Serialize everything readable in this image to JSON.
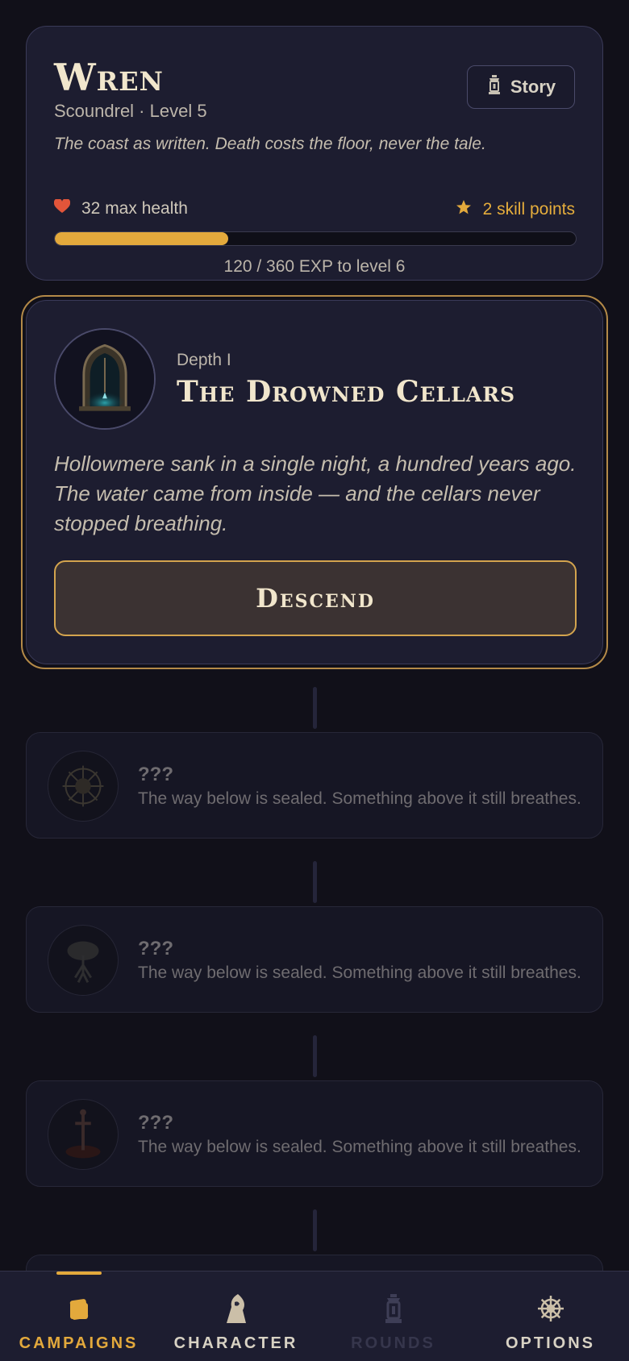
{
  "character": {
    "name": "Wren",
    "subtitle": "Scoundrel · Level 5",
    "tagline": "The coast as written. Death costs the floor, never the tale.",
    "story_label": "Story",
    "health_text": "32 max health",
    "skill_text": "2 skill points",
    "xp_current": 120,
    "xp_total": 360,
    "xp_text": "120 / 360 EXP to level 6"
  },
  "active_campaign": {
    "depth": "Depth I",
    "title": "The Drowned Cellars",
    "description": "Hollowmere sank in a single night, a hundred years ago. The water came from inside — and the cellars never stopped breathing.",
    "action_label": "Descend"
  },
  "locked_campaigns": [
    {
      "title": "???",
      "description": "The way below is sealed. Something above it still breathes.",
      "icon": "sigil-icon"
    },
    {
      "title": "???",
      "description": "The way below is sealed. Something above it still breathes.",
      "icon": "tree-icon"
    },
    {
      "title": "???",
      "description": "The way below is sealed. Something above it still breathes.",
      "icon": "sword-icon"
    }
  ],
  "nav": {
    "tabs": [
      {
        "label": "CAMPAIGNS",
        "icon": "cards-icon",
        "active": true
      },
      {
        "label": "CHARACTER",
        "icon": "hooded-figure-icon",
        "active": false
      },
      {
        "label": "ROUNDS",
        "icon": "lantern-icon",
        "active": false,
        "disabled": true
      },
      {
        "label": "OPTIONS",
        "icon": "helm-wheel-icon",
        "active": false
      }
    ]
  },
  "colors": {
    "accent": "#e3a93c",
    "heart": "#e2553a",
    "background": "#111019",
    "card": "#1d1d30"
  }
}
